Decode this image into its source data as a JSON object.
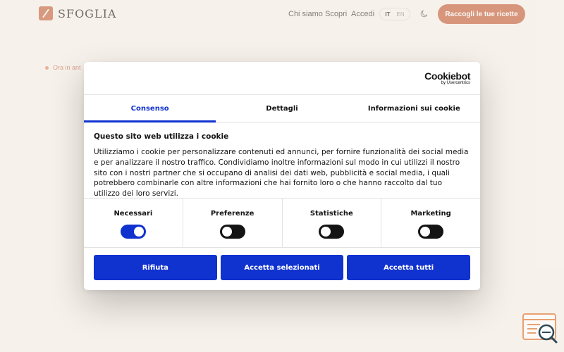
{
  "site": {
    "brand": "SFOGLIA",
    "nav": [
      "Chi siamo",
      "Scopri",
      "Accedi"
    ],
    "lang_active": "IT",
    "lang_other": "EN",
    "cta": "Raccogli le tue ricette",
    "oven_text": "Ora in ant"
  },
  "cookie_dialog": {
    "provider_name": "Cookiebot",
    "provider_sub": "by Usercentrics",
    "tabs": [
      "Consenso",
      "Dettagli",
      "Informazioni sui cookie"
    ],
    "active_tab": "Consenso",
    "heading": "Questo sito web utilizza i cookie",
    "body": "Utilizziamo i cookie per personalizzare contenuti ed annunci, per fornire funzionalità dei social media e per analizzare il nostro traffico. Condividiamo inoltre informazioni sul modo in cui utilizzi il nostro sito con i nostri partner che si occupano di analisi dei dati web, pubblicità e social media, i quali potrebbero combinarle con altre informazioni che hai fornito loro o che hanno raccolto dal tuo utilizzo dei loro servizi.",
    "categories": [
      {
        "label": "Necessari",
        "enabled": true
      },
      {
        "label": "Preferenze",
        "enabled": false
      },
      {
        "label": "Statistiche",
        "enabled": false
      },
      {
        "label": "Marketing",
        "enabled": false
      }
    ],
    "buttons": [
      "Rifiuta",
      "Accetta selezionati",
      "Accetta tutti"
    ]
  },
  "colors": {
    "accent": "#1032cf",
    "brand": "#c6643f",
    "background": "#f7f2ec"
  },
  "icons": [
    "pen-logo-icon",
    "moon-icon",
    "cookie-search-badge-icon"
  ]
}
